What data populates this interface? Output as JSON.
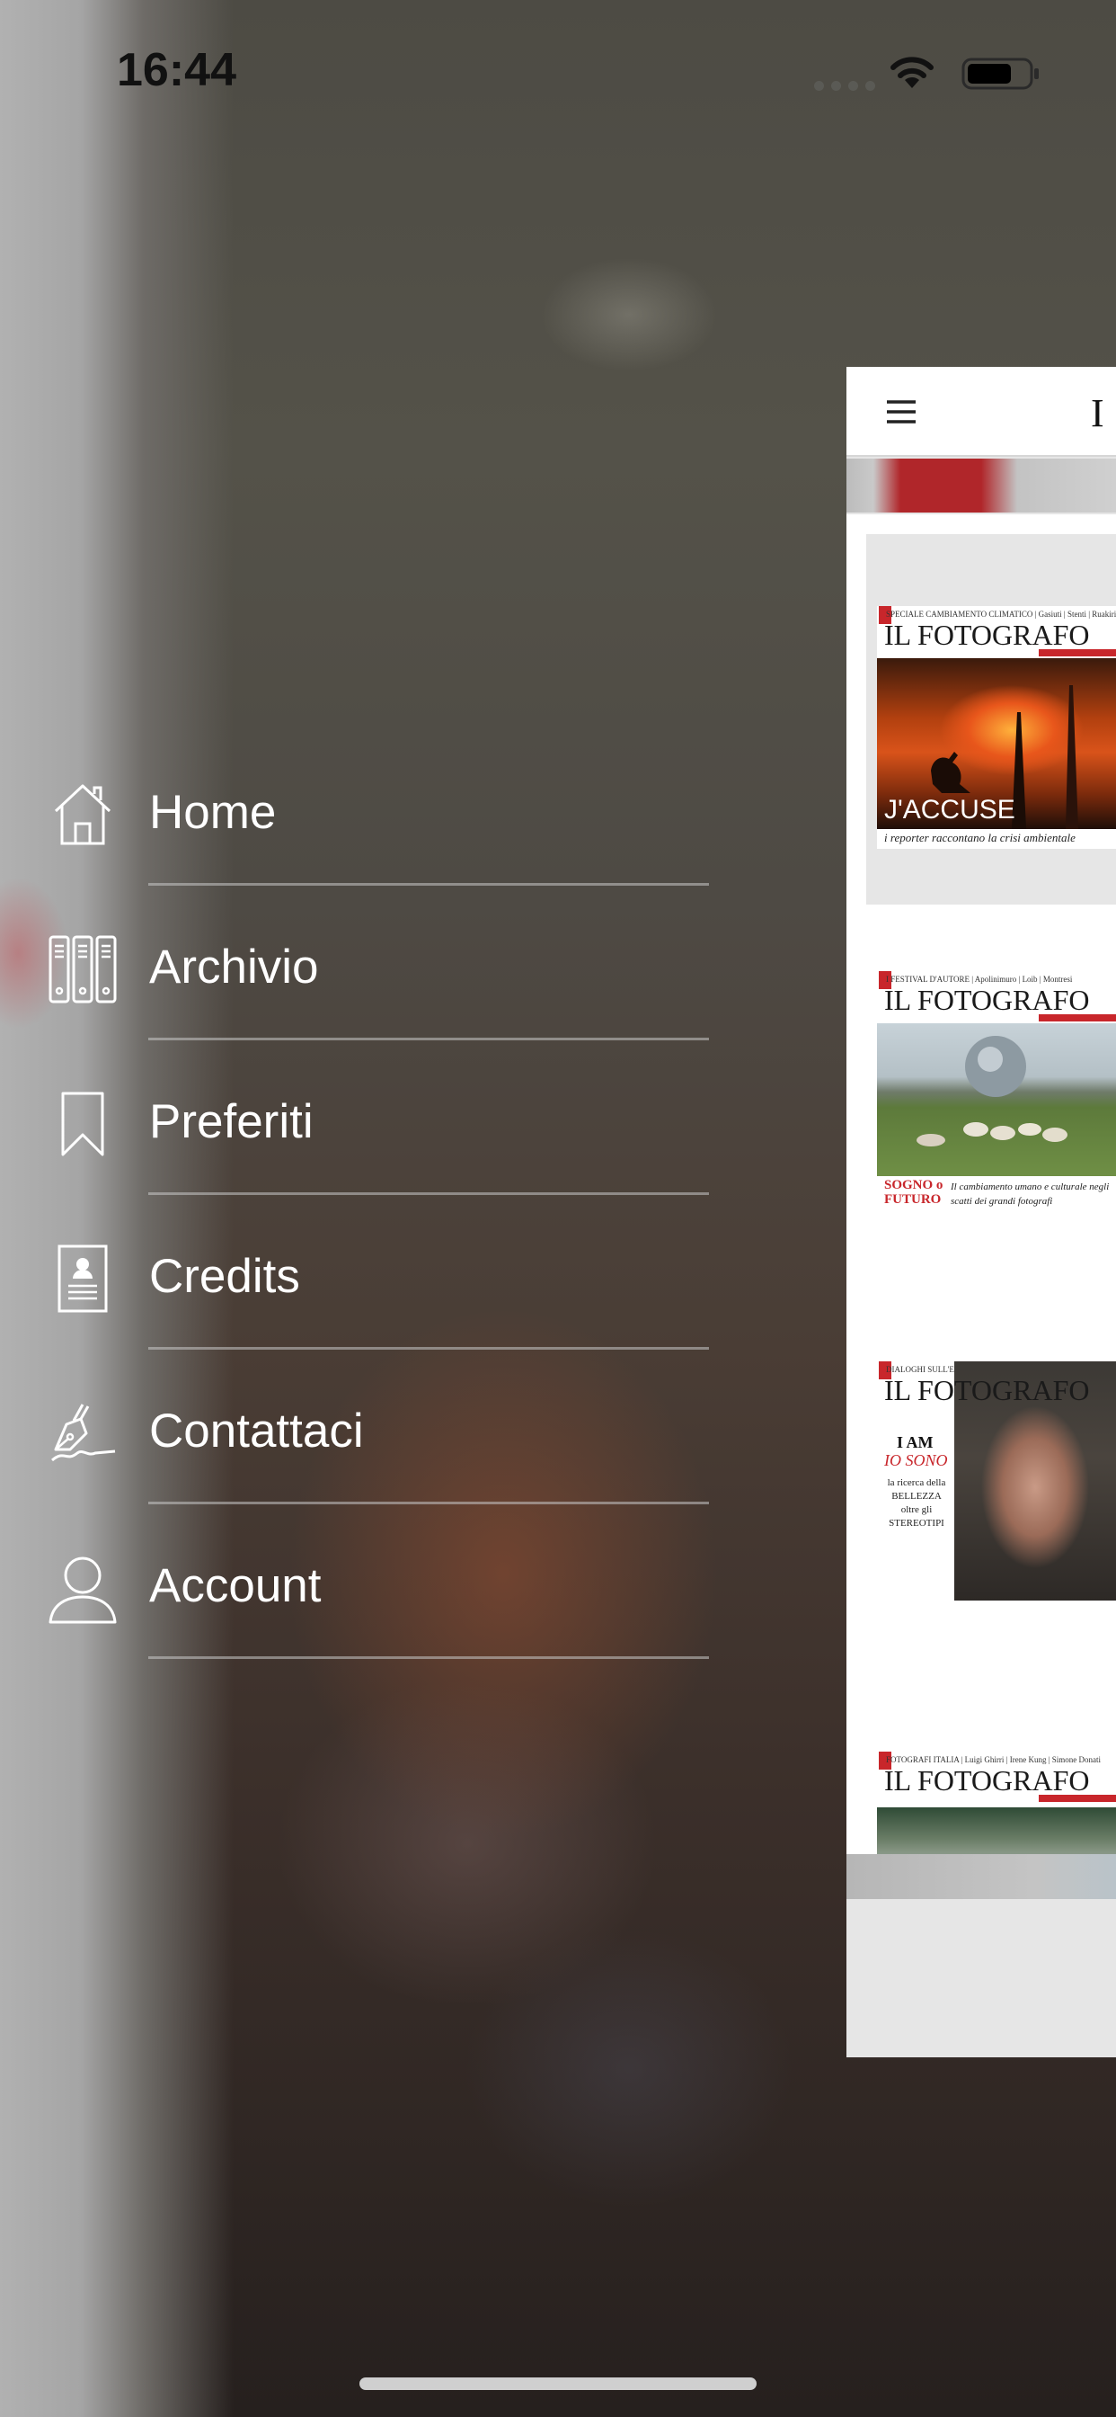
{
  "status_bar": {
    "time": "16:44",
    "icons": [
      "signal-dots-icon",
      "wifi-icon",
      "battery-icon"
    ]
  },
  "menu": {
    "items": [
      {
        "label": "Home",
        "icon": "home-icon"
      },
      {
        "label": "Archivio",
        "icon": "binders-icon"
      },
      {
        "label": "Preferiti",
        "icon": "bookmark-icon"
      },
      {
        "label": "Credits",
        "icon": "id-badge-icon"
      },
      {
        "label": "Contattaci",
        "icon": "pen-signature-icon"
      },
      {
        "label": "Account",
        "icon": "person-icon"
      }
    ]
  },
  "app_preview": {
    "header_logo_fragment": "I",
    "menu_icon": "hamburger-icon",
    "issues": [
      {
        "topline": "SPECIALE CAMBIAMENTO CLIMATICO | Gasiuti | Stenti | Ruakiri",
        "masthead": "IL FOTOGRAFO",
        "headline": "J'ACCUSE",
        "caption": "i reporter raccontano la crisi ambientale"
      },
      {
        "topline": "I FESTIVAL D'AUTORE | Apolinimuro | Loib | Montresi",
        "masthead": "IL FOTOGRAFO",
        "headline": "SOGNO o FUTURO",
        "caption": "Il cambiamento umano e culturale negli scatti dei grandi fotografi"
      },
      {
        "topline": "DIALOGHI SULL'ESTETICA | forme | sensuali | culture | generi",
        "masthead": "IL FOTOGRAFO",
        "headline": "I AM",
        "headline_italic": "IO SONO",
        "caption": "la ricerca della BELLEZZA oltre gli STEREOTIPI"
      },
      {
        "topline": "FOTOGRAFI ITALIA | Luigi Ghirri | Irene Kung | Simone Donati",
        "masthead": "IL FOTOGRAFO"
      }
    ]
  },
  "colors": {
    "accent_red": "#c8262b",
    "menu_text": "#ffffff"
  }
}
